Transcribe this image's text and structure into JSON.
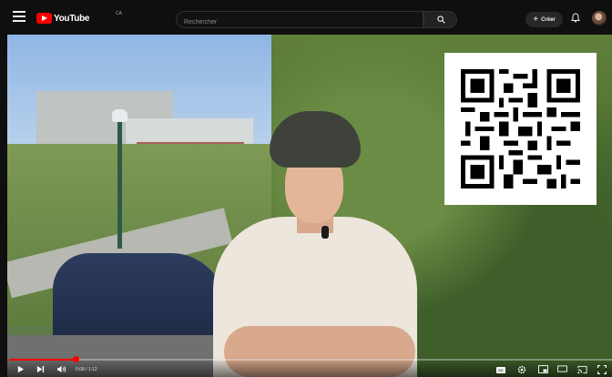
{
  "header": {
    "logo_text": "YouTube",
    "logo_country": "CA",
    "search_placeholder": "Rechercher",
    "create_label": "Créer"
  },
  "player": {
    "time_display": "0:08 / 1:12",
    "progress": 0.11,
    "cc_label": "CC"
  },
  "icons": [
    "menu-icon",
    "youtube-logo-icon",
    "search-icon",
    "plus-icon",
    "bell-icon",
    "avatar",
    "play-icon",
    "next-icon",
    "volume-icon",
    "cc-icon",
    "settings-icon",
    "miniplayer-icon",
    "theater-icon",
    "cast-icon",
    "fullscreen-icon"
  ],
  "colors": {
    "brand_red": "#ff0000",
    "background": "#0f0f0f"
  }
}
